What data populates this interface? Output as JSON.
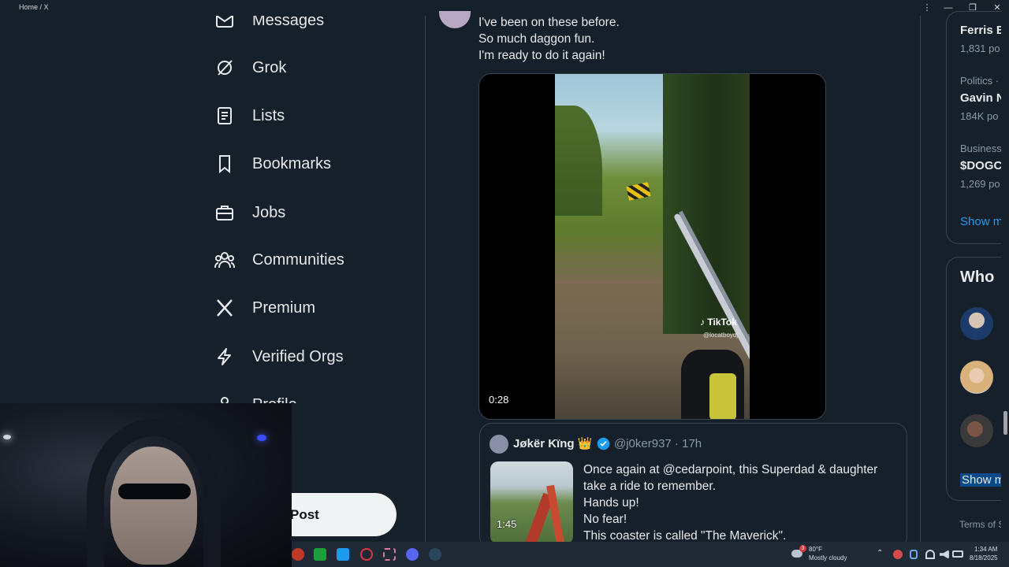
{
  "window": {
    "title": "Home / X",
    "controls": [
      "⋮",
      "—",
      "❐",
      "✕"
    ]
  },
  "nav": {
    "items": [
      {
        "label": "Messages",
        "icon": "mail-icon"
      },
      {
        "label": "Grok",
        "icon": "grok-icon"
      },
      {
        "label": "Lists",
        "icon": "list-icon"
      },
      {
        "label": "Bookmarks",
        "icon": "bookmark-icon"
      },
      {
        "label": "Jobs",
        "icon": "briefcase-icon"
      },
      {
        "label": "Communities",
        "icon": "people-icon"
      },
      {
        "label": "Premium",
        "icon": "x-logo-icon"
      },
      {
        "label": "Verified Orgs",
        "icon": "lightning-icon"
      },
      {
        "label": "Profile",
        "icon": "person-icon"
      }
    ],
    "post_button": "Post"
  },
  "post": {
    "lines": [
      "I've been on these before.",
      "So much daggon fun.",
      "I'm ready to do it again!"
    ],
    "video": {
      "duration": "0:28",
      "watermark": "TikTok",
      "watermark_user": "@locatboydj"
    }
  },
  "quoted_post": {
    "name": "Jøkër Kïng 👑",
    "handle": "@j0ker937 · 17h",
    "thumb_duration": "1:45",
    "lines": [
      "Once again at @cedarpoint, this Superdad & daughter",
      "take a ride to remember.",
      "Hands up!",
      "No fear!",
      "This coaster is called \"The Maverick\"."
    ]
  },
  "sidebar": {
    "trends": [
      {
        "category": "",
        "title": "Ferris E",
        "count": "1,831 po"
      },
      {
        "category": "Politics ·",
        "title": "Gavin N",
        "count": "184K po"
      },
      {
        "category": "Business",
        "title": "$DOGC",
        "count": "1,269 po"
      }
    ],
    "show_more_1": "Show m",
    "who_to_follow": "Who",
    "show_more_2": "Show m",
    "terms": "Terms of S"
  },
  "taskbar": {
    "weather_temp": "80°F",
    "weather_desc": "Mostly cloudy",
    "weather_badge": "3",
    "time": "1:34 AM",
    "date": "8/18/2025"
  },
  "colors": {
    "background": "#15202b",
    "accent": "#1d9bf0",
    "border": "#38444d",
    "verified": "#1d9bf0"
  }
}
